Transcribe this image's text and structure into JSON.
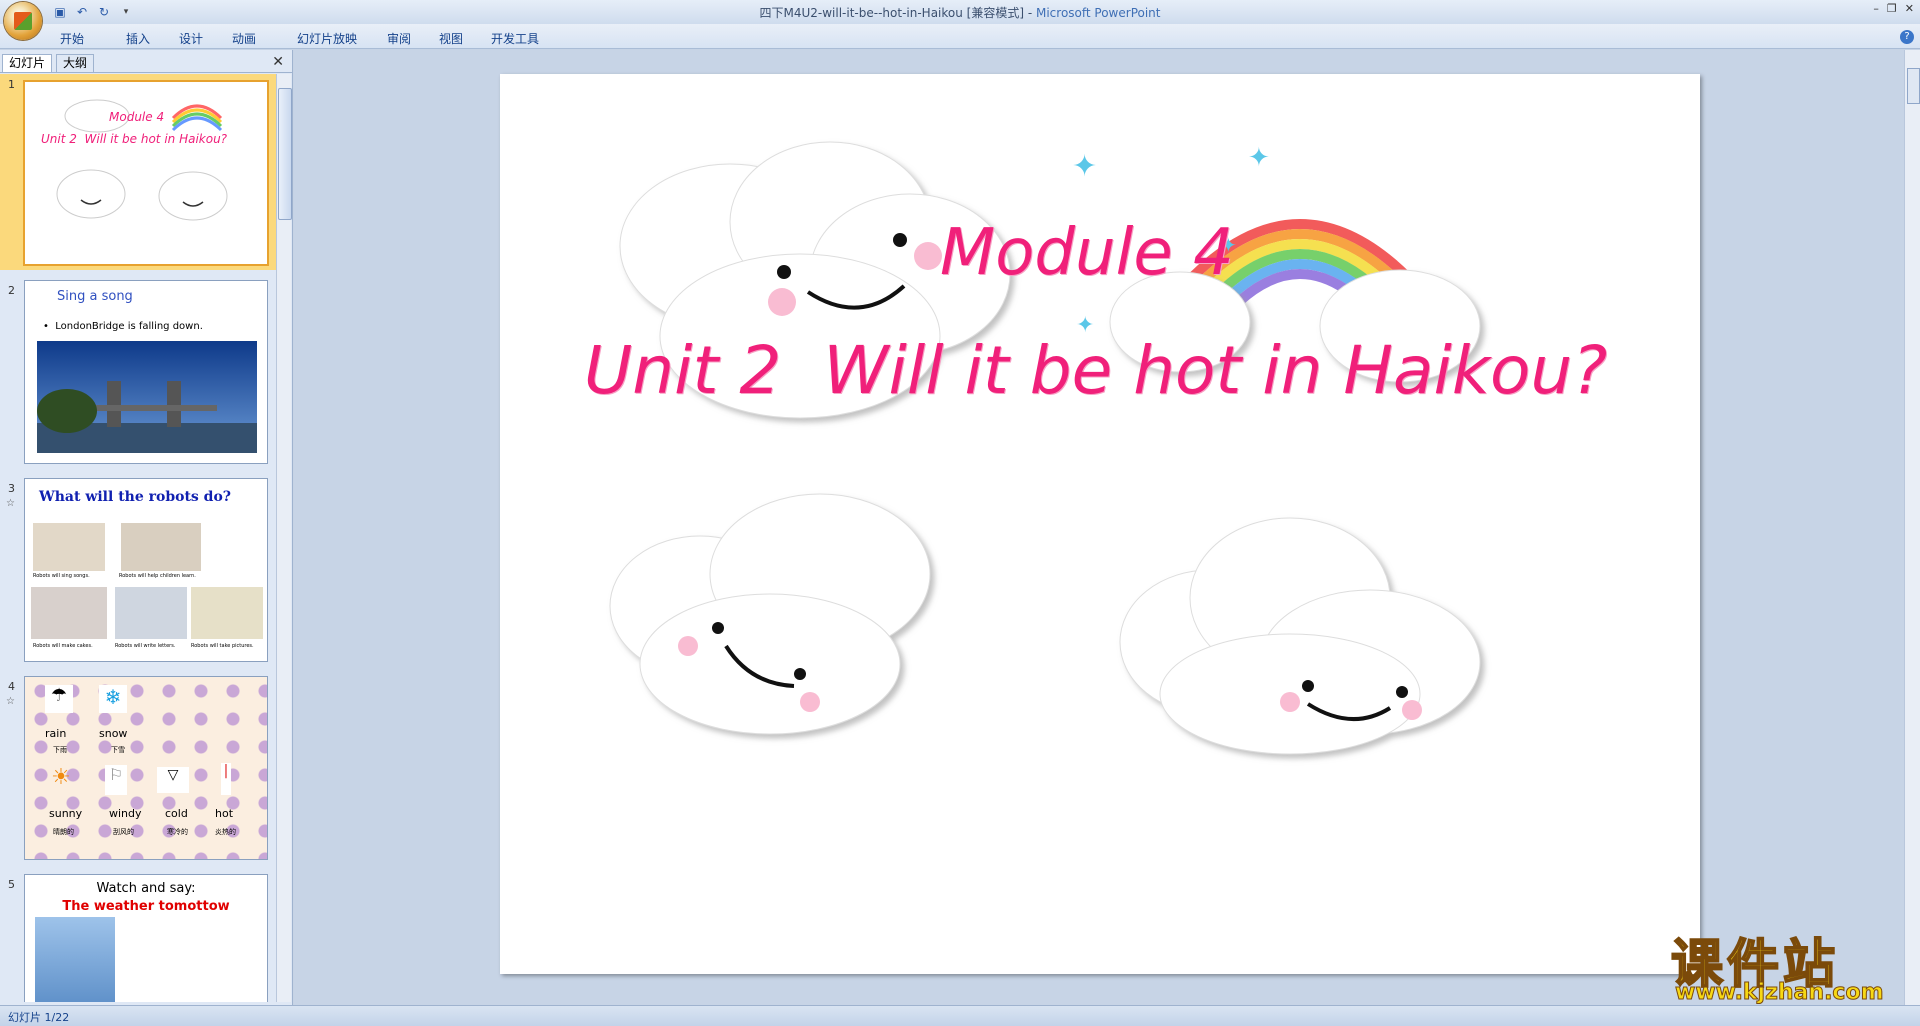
{
  "window": {
    "title": "四下M4U2-will-it-be--hot-in-Haikou [兼容模式] - ",
    "app_name": "Microsoft PowerPoint"
  },
  "ribbon": {
    "tabs": [
      "开始",
      "插入",
      "设计",
      "动画",
      "幻灯片放映",
      "审阅",
      "视图",
      "开发工具"
    ]
  },
  "panel": {
    "tab_slides": "幻灯片",
    "tab_outline": "大纲"
  },
  "thumbnails": [
    {
      "number": "1",
      "module": "Module 4",
      "unit": "Unit 2  Will it be hot in Haikou?"
    },
    {
      "number": "2",
      "title": "Sing a song",
      "bullet": "LondonBridge is falling down."
    },
    {
      "number": "3",
      "title": "What will the robots do?",
      "captions": [
        "Robots will  sing songs.",
        "Robots will  help  children  learn.",
        "Robots will  make cakes.",
        "Robots will  write letters.",
        "Robots will  take pictures."
      ]
    },
    {
      "number": "4",
      "words": [
        {
          "en": "rain",
          "zh": "下雨"
        },
        {
          "en": "snow",
          "zh": "下雪"
        },
        {
          "en": "sunny",
          "zh": "晴朗的"
        },
        {
          "en": "windy",
          "zh": "刮风的"
        },
        {
          "en": "cold",
          "zh": "寒冷的"
        },
        {
          "en": "hot",
          "zh": "炎热的"
        }
      ]
    },
    {
      "number": "5",
      "line1": "Watch and say:",
      "line2": "The weather tomottow"
    }
  ],
  "slide": {
    "module": "Module 4",
    "unit": "Unit 2  Will it be hot in Haikou?"
  },
  "status": {
    "slide_info": "幻灯片 1/22"
  },
  "watermark": {
    "cn": "课件站",
    "url": "www.kjzhan.com"
  },
  "colors": {
    "title_pink": "#f0207a",
    "selection": "#fbd97c"
  }
}
